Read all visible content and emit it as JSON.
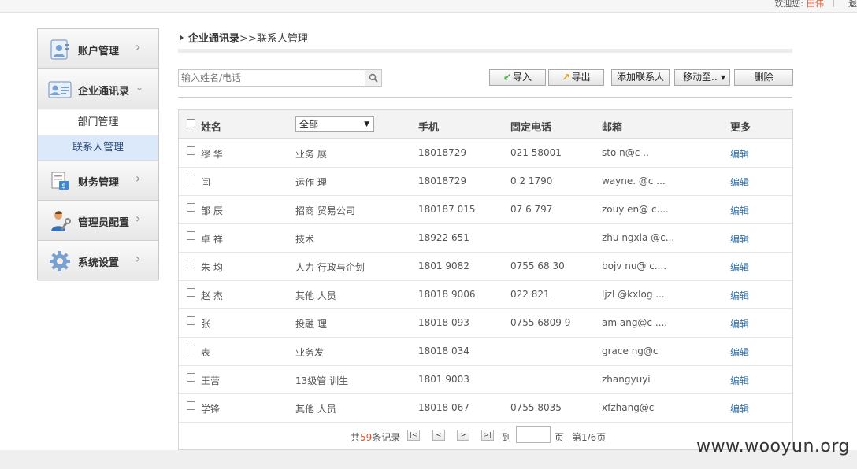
{
  "topbar": {
    "welcome": "欢迎您:",
    "username": "田伟",
    "exit": "退"
  },
  "sidebar": {
    "items": [
      {
        "label": "账户管理",
        "icon": "account-icon"
      },
      {
        "label": "企业通讯录",
        "icon": "contacts-card-icon"
      },
      {
        "label": "财务管理",
        "icon": "finance-icon"
      },
      {
        "label": "管理员配置",
        "icon": "admin-icon"
      },
      {
        "label": "系统设置",
        "icon": "settings-gear-icon"
      }
    ],
    "subitems": [
      {
        "label": "部门管理"
      },
      {
        "label": "联系人管理",
        "active": true
      }
    ]
  },
  "breadcrumb": {
    "root": "企业通讯录",
    "sep": ">>",
    "current": "联系人管理"
  },
  "search": {
    "placeholder": "输入姓名/电话"
  },
  "toolbar": {
    "import": "导入",
    "export": "导出",
    "add": "添加联系人",
    "move": "移动至..",
    "delete": "删除"
  },
  "table": {
    "headers": {
      "name": "姓名",
      "dept_filter": "全部",
      "mobile": "手机",
      "phone": "固定电话",
      "email": "邮箱",
      "more": "更多"
    },
    "rows": [
      {
        "name": "缪  华",
        "dept": "业务  展",
        "mobile": "18018729",
        "phone": "021  58001",
        "email": "sto      n@c  ..",
        "action": "编辑"
      },
      {
        "name": "闫",
        "dept": "运作  理",
        "mobile": "18018729",
        "phone": "0    2   1790",
        "email": "wayne.  @c  ...",
        "action": "编辑"
      },
      {
        "name": "邹   辰",
        "dept": "招商   贸易公司",
        "mobile": "180187  015",
        "phone": "07   6   797",
        "email": "zouy    en@    c....",
        "action": "编辑"
      },
      {
        "name": "卓   祥",
        "dept": "技术    ",
        "mobile": "18922   651",
        "phone": "",
        "email": "zhu   ngxia   @c...",
        "action": "编辑"
      },
      {
        "name": "朱   均",
        "dept": "人力    行政与企划",
        "mobile": "1801    9082",
        "phone": "0755  68   30",
        "email": "bojv   nu@    c....",
        "action": "编辑"
      },
      {
        "name": "赵    杰",
        "dept": "其他    人员",
        "mobile": "18018   9006",
        "phone": "022  821",
        "email": "ljzl   @kxlog  ...",
        "action": "编辑"
      },
      {
        "name": "张",
        "dept": "投融    理",
        "mobile": "18018   093",
        "phone": "0755  6809  9",
        "email": "am   ang@c   ....",
        "action": "编辑"
      },
      {
        "name": "   表",
        "dept": "业务发",
        "mobile": "18018   034",
        "phone": "",
        "email": "grace    ng@c",
        "action": "编辑"
      },
      {
        "name": "王营",
        "dept": "13级管    训生",
        "mobile": "1801    9003",
        "phone": "",
        "email": "zhangyuyi",
        "action": "编辑"
      },
      {
        "name": "   学锋",
        "dept": "其他    人员",
        "mobile": "18018   067",
        "phone": "0755    8035",
        "email": "xfzhang@c",
        "action": "编辑"
      }
    ]
  },
  "pagination": {
    "total_prefix": "共",
    "total": "59",
    "total_suffix": "条记录",
    "first": "|<",
    "prev": "<",
    "next": ">",
    "last": ">|",
    "goto": "到",
    "page_unit": "页",
    "page_info": "第1/6页"
  },
  "watermark": "www.wooyun.org"
}
